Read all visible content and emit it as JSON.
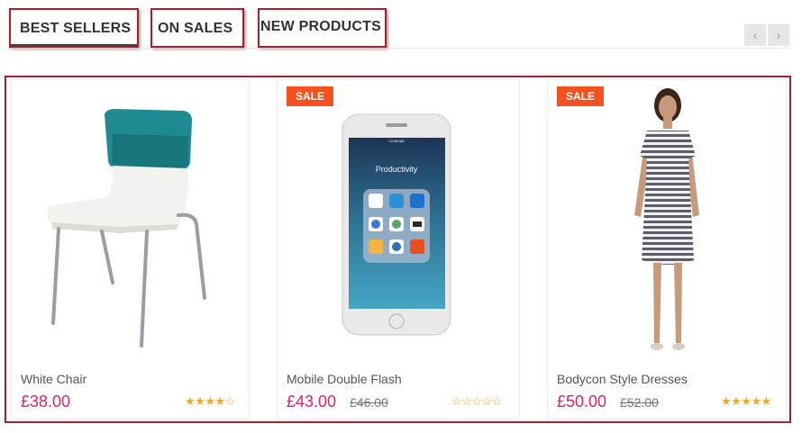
{
  "tabs": [
    {
      "label": "BEST SELLERS",
      "active": true
    },
    {
      "label": "ON SALES",
      "active": false
    },
    {
      "label": "NEW PRODUCTS",
      "active": false
    }
  ],
  "nav": {
    "prev_icon": "chevron-left-icon",
    "next_icon": "chevron-right-icon",
    "prev_glyph": "‹",
    "next_glyph": "›"
  },
  "products": [
    {
      "name": "White Chair",
      "price": "£38.00",
      "old_price": "",
      "sale": false,
      "rating": 4,
      "max_rating": 5
    },
    {
      "name": "Mobile Double Flash",
      "price": "£43.00",
      "old_price": "£46.00",
      "sale": true,
      "sale_label": "SALE",
      "rating": 0,
      "max_rating": 5,
      "phone_screen_title": "Productivity",
      "status_time": "12:58 AM"
    },
    {
      "name": "Bodycon Style Dresses",
      "price": "£50.00",
      "old_price": "£52.00",
      "sale": true,
      "sale_label": "SALE",
      "rating": 5,
      "max_rating": 5
    }
  ],
  "colors": {
    "accent_price": "#e0236a",
    "sale_badge": "#f4511e",
    "star": "#f5a623",
    "highlight_border": "#b01c2a"
  }
}
